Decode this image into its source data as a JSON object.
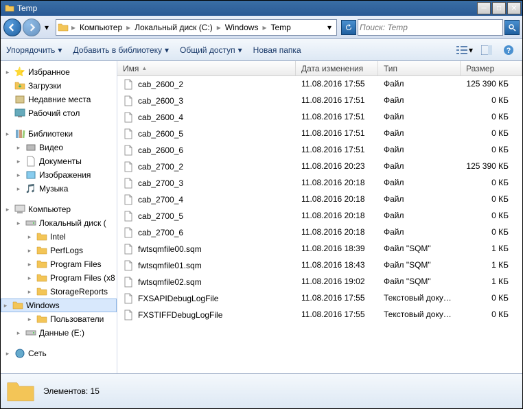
{
  "window": {
    "title": "Temp"
  },
  "breadcrumb": [
    "Компьютер",
    "Локальный диск (C:)",
    "Windows",
    "Temp"
  ],
  "search": {
    "placeholder": "Поиск: Temp"
  },
  "toolbar": {
    "organize": "Упорядочить",
    "include": "Добавить в библиотеку",
    "share": "Общий доступ",
    "newfolder": "Новая папка"
  },
  "tree": {
    "favorites": {
      "label": "Избранное",
      "items": [
        "Загрузки",
        "Недавние места",
        "Рабочий стол"
      ]
    },
    "libraries": {
      "label": "Библиотеки",
      "items": [
        "Видео",
        "Документы",
        "Изображения",
        "Музыка"
      ]
    },
    "computer": {
      "label": "Компьютер",
      "drive_c": {
        "label": "Локальный диск (",
        "folders": [
          "Intel",
          "PerfLogs",
          "Program Files",
          "Program Files (x8",
          "StorageReports",
          "Windows",
          "Пользователи"
        ]
      },
      "drive_e": "Данные (E:)"
    },
    "network": "Сеть"
  },
  "columns": {
    "name": "Имя",
    "date": "Дата изменения",
    "type": "Тип",
    "size": "Размер"
  },
  "files": [
    {
      "name": "cab_2600_2",
      "date": "11.08.2016 17:55",
      "type": "Файл",
      "size": "125 390 КБ"
    },
    {
      "name": "cab_2600_3",
      "date": "11.08.2016 17:51",
      "type": "Файл",
      "size": "0 КБ"
    },
    {
      "name": "cab_2600_4",
      "date": "11.08.2016 17:51",
      "type": "Файл",
      "size": "0 КБ"
    },
    {
      "name": "cab_2600_5",
      "date": "11.08.2016 17:51",
      "type": "Файл",
      "size": "0 КБ"
    },
    {
      "name": "cab_2600_6",
      "date": "11.08.2016 17:51",
      "type": "Файл",
      "size": "0 КБ"
    },
    {
      "name": "cab_2700_2",
      "date": "11.08.2016 20:23",
      "type": "Файл",
      "size": "125 390 КБ"
    },
    {
      "name": "cab_2700_3",
      "date": "11.08.2016 20:18",
      "type": "Файл",
      "size": "0 КБ"
    },
    {
      "name": "cab_2700_4",
      "date": "11.08.2016 20:18",
      "type": "Файл",
      "size": "0 КБ"
    },
    {
      "name": "cab_2700_5",
      "date": "11.08.2016 20:18",
      "type": "Файл",
      "size": "0 КБ"
    },
    {
      "name": "cab_2700_6",
      "date": "11.08.2016 20:18",
      "type": "Файл",
      "size": "0 КБ"
    },
    {
      "name": "fwtsqmfile00.sqm",
      "date": "11.08.2016 18:39",
      "type": "Файл \"SQM\"",
      "size": "1 КБ"
    },
    {
      "name": "fwtsqmfile01.sqm",
      "date": "11.08.2016 18:43",
      "type": "Файл \"SQM\"",
      "size": "1 КБ"
    },
    {
      "name": "fwtsqmfile02.sqm",
      "date": "11.08.2016 19:02",
      "type": "Файл \"SQM\"",
      "size": "1 КБ"
    },
    {
      "name": "FXSAPIDebugLogFile",
      "date": "11.08.2016 17:55",
      "type": "Текстовый документ",
      "size": "0 КБ"
    },
    {
      "name": "FXSTIFFDebugLogFile",
      "date": "11.08.2016 17:55",
      "type": "Текстовый документ",
      "size": "0 КБ"
    }
  ],
  "status": {
    "label": "Элементов: 15"
  }
}
